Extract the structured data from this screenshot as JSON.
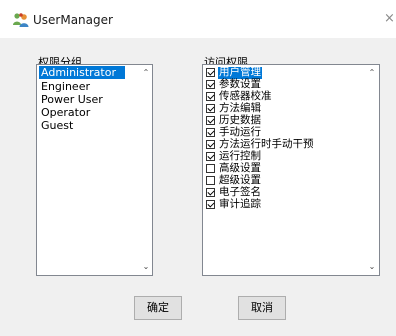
{
  "window": {
    "title": "UserManager",
    "close_glyph": "×"
  },
  "groups": {
    "label": "权限分组",
    "items": [
      "Administrator",
      "Engineer",
      "Power User",
      "Operator",
      "Guest"
    ],
    "selected": "Administrator"
  },
  "permissions": {
    "label": "访问权限",
    "items": [
      {
        "label": "用户管理",
        "checked": true,
        "selected": true
      },
      {
        "label": "参数设置",
        "checked": true
      },
      {
        "label": "传感器校准",
        "checked": true
      },
      {
        "label": "方法编辑",
        "checked": true
      },
      {
        "label": "历史数据",
        "checked": true
      },
      {
        "label": "手动运行",
        "checked": true
      },
      {
        "label": "方法运行时手动干预",
        "checked": true
      },
      {
        "label": "运行控制",
        "checked": true
      },
      {
        "label": "高级设置",
        "checked": false
      },
      {
        "label": "超级设置",
        "checked": false
      },
      {
        "label": "电子签名",
        "checked": true
      },
      {
        "label": "审计追踪",
        "checked": true
      }
    ]
  },
  "buttons": {
    "ok": "确定",
    "cancel": "取消"
  },
  "scroll": {
    "up_glyph": "⌃",
    "down_glyph": "⌄"
  },
  "colors": {
    "selection": "#0078d7",
    "window_bg": "#f0f0f0"
  },
  "icons": {
    "app": "users-icon",
    "close": "close-icon"
  }
}
